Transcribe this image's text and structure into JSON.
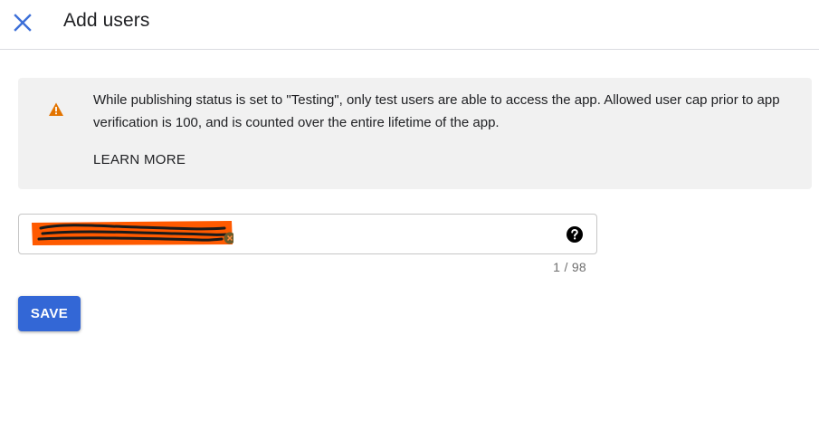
{
  "header": {
    "title": "Add users",
    "close_icon": "close-icon"
  },
  "alert": {
    "icon": "warning-icon",
    "message": "While publishing status is set to \"Testing\", only test users are able to access the app. Allowed user cap prior to app verification is 100, and is counted over the entire lifetime of the app.",
    "learn_more_label": "LEARN MORE"
  },
  "users_field": {
    "chips": [
      {
        "value": "",
        "redacted": true
      }
    ],
    "help_icon": "help-icon",
    "counter": "1 / 98"
  },
  "actions": {
    "save_label": "SAVE"
  },
  "colors": {
    "accent": "#3367d6",
    "close_icon": "#3c6fd8",
    "warning": "#e37400",
    "alert_bg": "#f1f1f1",
    "redaction": "#ff5a00"
  }
}
